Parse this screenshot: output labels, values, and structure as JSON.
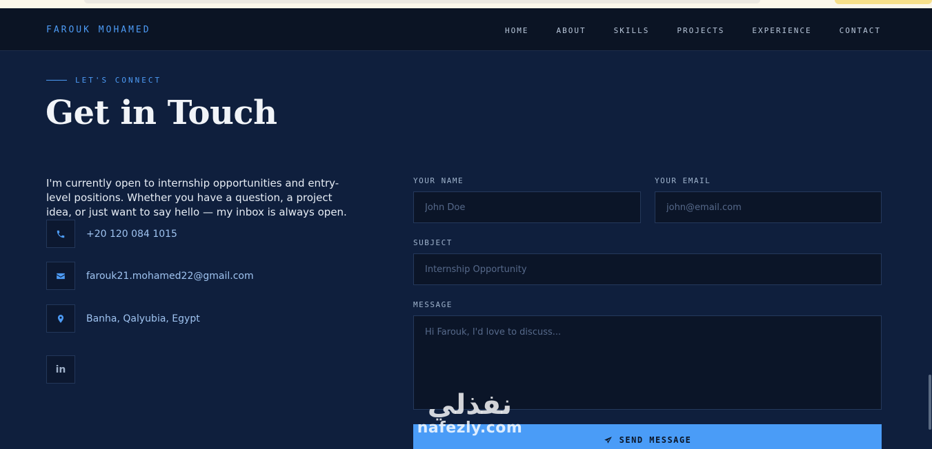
{
  "nav": {
    "brand": "FAROUK MOHAMED",
    "links": [
      "HOME",
      "ABOUT",
      "SKILLS",
      "PROJECTS",
      "EXPERIENCE",
      "CONTACT"
    ]
  },
  "hero": {
    "eyebrow": "LET'S CONNECT",
    "title": "Get in Touch",
    "intro": "I'm currently open to internship opportunities and entry-level positions. Whether you have a question, a project idea, or just want to say hello — my inbox is always open."
  },
  "contact": {
    "phone": "+20 120 084 1015",
    "email": "farouk21.mohamed22@gmail.com",
    "location": "Banha, Qalyubia, Egypt",
    "social_icon": "in"
  },
  "form": {
    "name_label": "YOUR NAME",
    "name_placeholder": "John Doe",
    "email_label": "YOUR EMAIL",
    "email_placeholder": "john@email.com",
    "subject_label": "SUBJECT",
    "subject_placeholder": "Internship Opportunity",
    "message_label": "MESSAGE",
    "message_placeholder": "Hi Farouk, I'd love to discuss...",
    "send_label": "SEND MESSAGE"
  },
  "watermark": {
    "arabic": "نفذلي",
    "latin": "nafezly.com"
  },
  "colors": {
    "background": "#0f1f3d",
    "navbar": "#0b1424",
    "accent": "#4a9cf7",
    "input_bg": "#0b1528"
  },
  "icons": {
    "phone": "phone-icon",
    "email": "envelope-icon",
    "location": "map-pin-icon",
    "linkedin": "linkedin-icon",
    "send": "paper-plane-icon"
  }
}
